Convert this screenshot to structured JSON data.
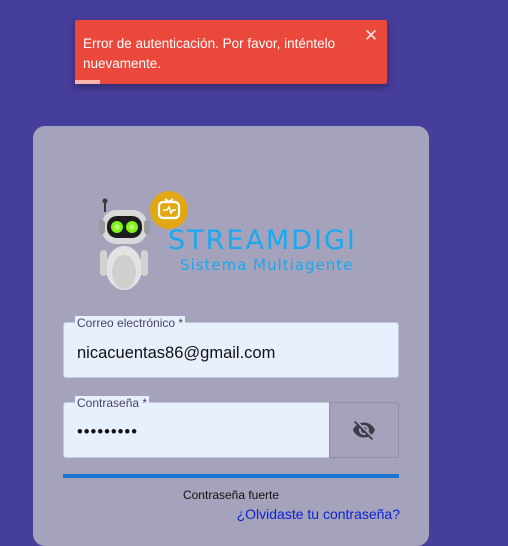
{
  "toast": {
    "message": "Error de autenticación. Por favor, inténtelo nuevamente.",
    "close_icon": "close-icon",
    "progress_fraction": 0.08,
    "color": "#e9483b"
  },
  "brand": {
    "title": "STREAMDIGI",
    "subtitle": "Sistema Multiagente",
    "color": "#1aa8f0",
    "logo_icon": "robot-logo"
  },
  "form": {
    "email": {
      "label": "Correo electrónico *",
      "value": "nicacuentas86@gmail.com"
    },
    "password": {
      "label": "Contraseña *",
      "value": "•••••••••",
      "toggle_icon": "eye-off-icon"
    },
    "strength": {
      "label": "Contraseña fuerte",
      "color": "#1976d2",
      "level_fraction": 1.0
    },
    "forgot_link": "¿Olvidaste tu contraseña?"
  },
  "colors": {
    "background": "#463e9b",
    "card": "#a5a3bb",
    "input_fill": "#e8f0fe",
    "link": "#0d22d6"
  }
}
